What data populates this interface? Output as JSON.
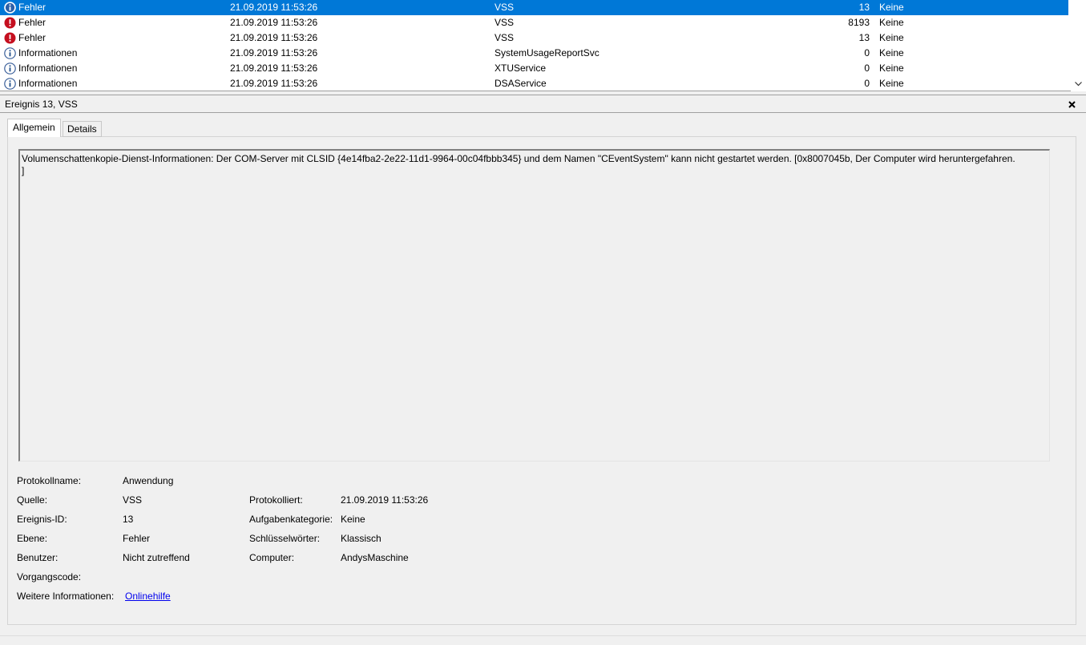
{
  "event_list": {
    "rows": [
      {
        "level": "Fehler",
        "icon": "info-icon",
        "date": "21.09.2019 11:53:26",
        "source": "VSS",
        "id": "13",
        "task": "Keine",
        "selected": true
      },
      {
        "level": "Fehler",
        "icon": "error-icon",
        "date": "21.09.2019 11:53:26",
        "source": "VSS",
        "id": "8193",
        "task": "Keine",
        "selected": false
      },
      {
        "level": "Fehler",
        "icon": "error-icon",
        "date": "21.09.2019 11:53:26",
        "source": "VSS",
        "id": "13",
        "task": "Keine",
        "selected": false
      },
      {
        "level": "Informationen",
        "icon": "info-icon",
        "date": "21.09.2019 11:53:26",
        "source": "SystemUsageReportSvc",
        "id": "0",
        "task": "Keine",
        "selected": false
      },
      {
        "level": "Informationen",
        "icon": "info-icon",
        "date": "21.09.2019 11:53:26",
        "source": "XTUService",
        "id": "0",
        "task": "Keine",
        "selected": false
      },
      {
        "level": "Informationen",
        "icon": "info-icon",
        "date": "21.09.2019 11:53:26",
        "source": "DSAService",
        "id": "0",
        "task": "Keine",
        "selected": false
      }
    ]
  },
  "detail": {
    "title": "Ereignis 13, VSS",
    "tabs": {
      "general": "Allgemein",
      "details": "Details"
    },
    "message": "Volumenschattenkopie-Dienst-Informationen: Der COM-Server mit CLSID {4e14fba2-2e22-11d1-9964-00c04fbbb345} und dem Namen \"CEventSystem\" kann nicht gestartet werden. [0x8007045b, Der Computer wird heruntergefahren.\n]",
    "properties": {
      "log_name_label": "Protokollname:",
      "log_name": "Anwendung",
      "source_label": "Quelle:",
      "source": "VSS",
      "logged_label": "Protokolliert:",
      "logged": "21.09.2019 11:53:26",
      "event_id_label": "Ereignis-ID:",
      "event_id": "13",
      "task_category_label": "Aufgabenkategorie:",
      "task_category": "Keine",
      "level_label": "Ebene:",
      "level": "Fehler",
      "keywords_label": "Schlüsselwörter:",
      "keywords": "Klassisch",
      "user_label": "Benutzer:",
      "user": "Nicht zutreffend",
      "computer_label": "Computer:",
      "computer": "AndysMaschine",
      "opcode_label": "Vorgangscode:",
      "more_info_label": "Weitere Informationen:",
      "more_info_link": "Onlinehilfe"
    }
  },
  "colors": {
    "selection": "#0078d7",
    "error": "#c50f1f",
    "info": "#1f4e8c",
    "link": "#0000ee"
  }
}
